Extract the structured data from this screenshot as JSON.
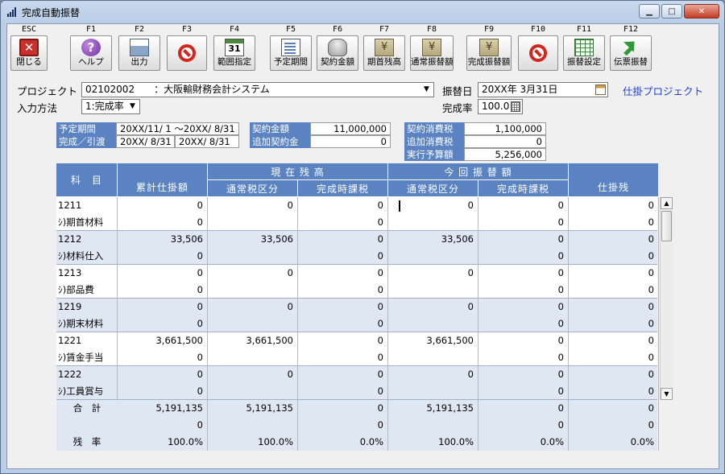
{
  "window": {
    "title": "完成自動振替"
  },
  "toolbar": [
    {
      "key": "ESC",
      "label": "閉じる",
      "icon": "exit-icon"
    },
    {
      "key": "F1",
      "label": "ヘルプ",
      "icon": "help-icon"
    },
    {
      "key": "F2",
      "label": "出力",
      "icon": "print-icon"
    },
    {
      "key": "F3",
      "label": "",
      "icon": "stop-icon"
    },
    {
      "key": "F4",
      "label": "範囲指定",
      "icon": "calendar-icon"
    },
    {
      "key": "F5",
      "label": "予定期間",
      "icon": "document-icon"
    },
    {
      "key": "F6",
      "label": "契約金額",
      "icon": "coins-icon"
    },
    {
      "key": "F7",
      "label": "期首残高",
      "icon": "money-icon"
    },
    {
      "key": "F8",
      "label": "通常振替額",
      "icon": "money-transfer-icon"
    },
    {
      "key": "F9",
      "label": "完成振替額",
      "icon": "money-complete-icon"
    },
    {
      "key": "F10",
      "label": "",
      "icon": "stop-icon"
    },
    {
      "key": "F11",
      "label": "振替設定",
      "icon": "grid-icon"
    },
    {
      "key": "F12",
      "label": "伝票振替",
      "icon": "arrow-icon"
    }
  ],
  "cal_icon_text": "31",
  "form": {
    "project_label": "プロジェクト",
    "project_value": "02102002　　：大阪輸財務会計システム",
    "input_method_label": "入力方法",
    "input_method_value": "1:完成率",
    "transfer_date_label": "振替日",
    "transfer_date_value": "20XX年 3月31日",
    "completion_rate_label": "完成率",
    "completion_rate_value": "100.0",
    "wip_project_link": "仕掛プロジェクト"
  },
  "info": {
    "planned_period_label": "予定期間",
    "planned_period_value": "20XX/11/ 1 ～20XX/ 8/31",
    "completion_label": "完成／引渡",
    "completion_value_1": "20XX/ 8/31",
    "completion_value_2": "20XX/ 8/31",
    "contract_amount_label": "契約金額",
    "contract_amount_value": "11,000,000",
    "additional_contract_label": "追加契約金",
    "additional_contract_value": "0",
    "contract_tax_label": "契約消費税",
    "contract_tax_value": "1,100,000",
    "additional_tax_label": "追加消費税",
    "additional_tax_value": "0",
    "budget_label": "実行予算額",
    "budget_value": "5,256,000"
  },
  "grid": {
    "headers": {
      "account": "科　目",
      "cumulative": "累計仕掛額",
      "current_balance": "現 在 残 高",
      "this_transfer": "今 回 振 替 額",
      "normal_tax": "通常税区分",
      "completion_tax": "完成時課税",
      "normal_tax_2": "通常税区分",
      "completion_tax_2": "完成時課税",
      "wip_balance": "仕掛残"
    },
    "rows": [
      {
        "code": "1211",
        "name": "ｼ)期首材料",
        "cumulative": [
          "0",
          "0"
        ],
        "cur_normal": "0",
        "cur_completion": [
          "0",
          "0"
        ],
        "tr_normal": "0",
        "tr_completion": [
          "0",
          "0"
        ],
        "wip": [
          "0",
          "0"
        ]
      },
      {
        "code": "1212",
        "name": "ｼ)材料仕入",
        "cumulative": [
          "33,506",
          "0"
        ],
        "cur_normal": "33,506",
        "cur_completion": [
          "0",
          "0"
        ],
        "tr_normal": "33,506",
        "tr_completion": [
          "0",
          "0"
        ],
        "wip": [
          "0",
          "0"
        ]
      },
      {
        "code": "1213",
        "name": "ｼ)部品費",
        "cumulative": [
          "0",
          "0"
        ],
        "cur_normal": "0",
        "cur_completion": [
          "0",
          "0"
        ],
        "tr_normal": "0",
        "tr_completion": [
          "0",
          "0"
        ],
        "wip": [
          "0",
          "0"
        ]
      },
      {
        "code": "1219",
        "name": "ｼ)期末材料",
        "cumulative": [
          "0",
          "0"
        ],
        "cur_normal": "0",
        "cur_completion": [
          "0",
          "0"
        ],
        "tr_normal": "0",
        "tr_completion": [
          "0",
          "0"
        ],
        "wip": [
          "0",
          "0"
        ]
      },
      {
        "code": "1221",
        "name": "ｼ)賃金手当",
        "cumulative": [
          "3,661,500",
          "0"
        ],
        "cur_normal": "3,661,500",
        "cur_completion": [
          "0",
          "0"
        ],
        "tr_normal": "3,661,500",
        "tr_completion": [
          "0",
          "0"
        ],
        "wip": [
          "0",
          "0"
        ]
      },
      {
        "code": "1222",
        "name": "ｼ)工員賞与",
        "cumulative": [
          "0",
          "0"
        ],
        "cur_normal": "0",
        "cur_completion": [
          "0",
          "0"
        ],
        "tr_normal": "0",
        "tr_completion": [
          "0",
          "0"
        ],
        "wip": [
          "0",
          "0"
        ]
      }
    ],
    "totals": {
      "label": "合　計",
      "cumulative": [
        "5,191,135",
        "0"
      ],
      "cur_normal": "5,191,135",
      "cur_completion": [
        "0",
        "0"
      ],
      "tr_normal": "5,191,135",
      "tr_completion": [
        "0",
        "0"
      ],
      "wip": [
        "0",
        "0"
      ]
    },
    "ratio": {
      "label": "残　率",
      "cumulative": "100.0%",
      "cur_normal": "100.0%",
      "cur_completion": "0.0%",
      "tr_normal": "100.0%",
      "tr_completion": "0.0%",
      "wip": "0.0%"
    }
  },
  "colors": {
    "header_blue": "#5b83c1",
    "row_alt": "#dfe7f2",
    "link_blue": "#1d3fd1"
  }
}
